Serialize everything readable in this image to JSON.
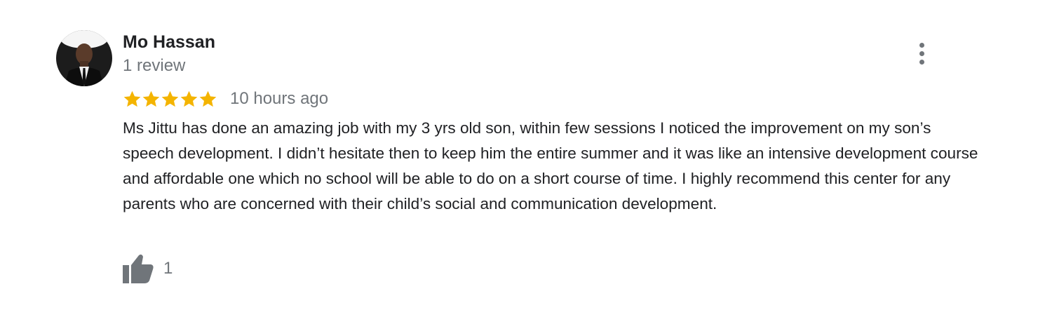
{
  "reviewer": {
    "name": "Mo Hassan",
    "review_count": "1 review",
    "avatar_icon": "person-avatar"
  },
  "rating": {
    "stars": 5,
    "max_stars": 5,
    "star_color": "#f4b400"
  },
  "timestamp": "10 hours ago",
  "review_text": "Ms Jittu has done an amazing job with my 3 yrs old son, within few sessions I noticed the improvement on my son’s speech development. I didn’t hesitate then to keep him the entire summer and it was like an intensive development course and affordable one which no school will be able to do on a short course of time. I highly recommend this center for any parents who are concerned with their child’s social and communication development.",
  "actions": {
    "more_icon": "more-vert-icon",
    "like_icon": "thumbs-up-icon",
    "like_count": "1"
  },
  "colors": {
    "name_text": "#202124",
    "secondary_text": "#70757a",
    "icon_gray": "#70757a"
  }
}
